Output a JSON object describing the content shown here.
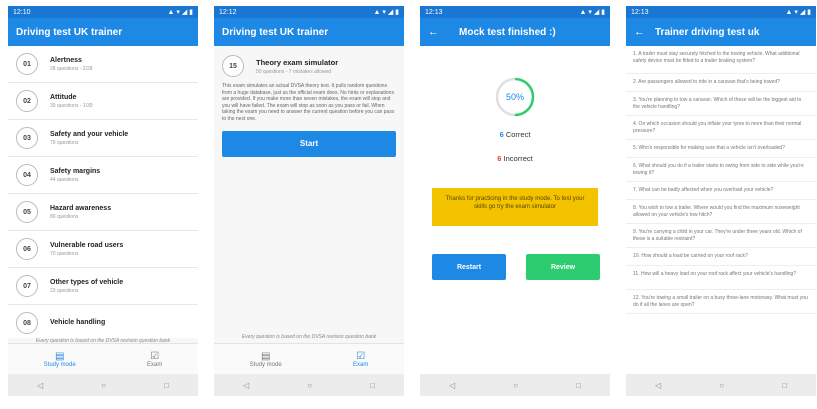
{
  "screen1": {
    "time": "12:10",
    "title": "Driving test UK trainer",
    "topics": [
      {
        "num": "01",
        "title": "Alertness",
        "sub": "28 questions - 2/28"
      },
      {
        "num": "02",
        "title": "Attitude",
        "sub": "39 questions - 1/39"
      },
      {
        "num": "03",
        "title": "Safety and your vehicle",
        "sub": "79 questions"
      },
      {
        "num": "04",
        "title": "Safety margins",
        "sub": "44 questions"
      },
      {
        "num": "05",
        "title": "Hazard awareness",
        "sub": "80 questions"
      },
      {
        "num": "06",
        "title": "Vulnerable road users",
        "sub": "70 questions"
      },
      {
        "num": "07",
        "title": "Other types of vehicle",
        "sub": "23 questions"
      },
      {
        "num": "08",
        "title": "Vehicle handling",
        "sub": ""
      }
    ],
    "footnote": "Every question is based on the DVSA revision question bank",
    "nav": {
      "study": "Study mode",
      "exam": "Exam"
    }
  },
  "screen2": {
    "time": "12:12",
    "title": "Driving test UK trainer",
    "num": "15",
    "exam_title": "Theory exam simulator",
    "exam_sub": "50 questions - 7 mistakes allowed",
    "description": "This exam simulates an actual DVSA theory test. It pulls random questions from a huge database, just as the official exam does. No hints or explanations are provided. If you make more than seven mistakes, the exam will stop and you will have failed. The exam will stop as soon as you pass or fail. When taking the exam you need to answer the current question before you can pass to the next one.",
    "start": "Start",
    "footnote": "Every question is based on the DVSA revision question bank",
    "nav": {
      "study": "Study mode",
      "exam": "Exam"
    }
  },
  "screen3": {
    "time": "12:13",
    "title": "Mock test finished :)",
    "percent": "50%",
    "progress": 0.5,
    "correct_num": "6",
    "correct_label": "Correct",
    "incorrect_num": "6",
    "incorrect_label": "Incorrect",
    "banner": "Thanks for practicing in the study mode. To test your skills go try the exam simulator",
    "restart": "Restart",
    "review": "Review"
  },
  "screen4": {
    "time": "12:13",
    "title": "Trainer driving test uk",
    "questions": [
      "1. A trailer must stay securely hitched to the towing vehicle. What additional safety device must be fitted to a trailer braking system?",
      "2. Are passengers allowed to ride in a caravan that's being towed?",
      "3. You're planning to tow a caravan. Which of these will be the biggest aid to the vehicle handling?",
      "4. On which occasion should you inflate your tyres to more than their normal pressure?",
      "5. Who's responsible for making sure that a vehicle isn't overloaded?",
      "6. What should you do if a trailer starts to swing from side to side while you're towing it?",
      "7. What can be badly affected when you overload your vehicle?",
      "8. You wish to tow a trailer. Where would you find the maximum noseweight allowed on your vehicle's tow hitch?",
      "9. You're carrying a child in your car. They're under three years old. Which of these is a suitable restraint?",
      "10. How should a load be carried on your roof rack?",
      "11. How will a heavy load on your roof rack affect your vehicle's handling?",
      "12. You're towing a small trailer on a busy three-lane motorway. What must you do if all the lanes are open?"
    ]
  },
  "colors": {
    "primary": "#1e88e5",
    "status": "#1976d2",
    "success": "#2ecc71",
    "warning": "#f3c300",
    "incorrect": "#e53935"
  },
  "icons": [
    "back-arrow-icon",
    "study-mode-icon",
    "exam-icon",
    "nav-back-icon",
    "nav-home-icon",
    "nav-recents-icon"
  ]
}
